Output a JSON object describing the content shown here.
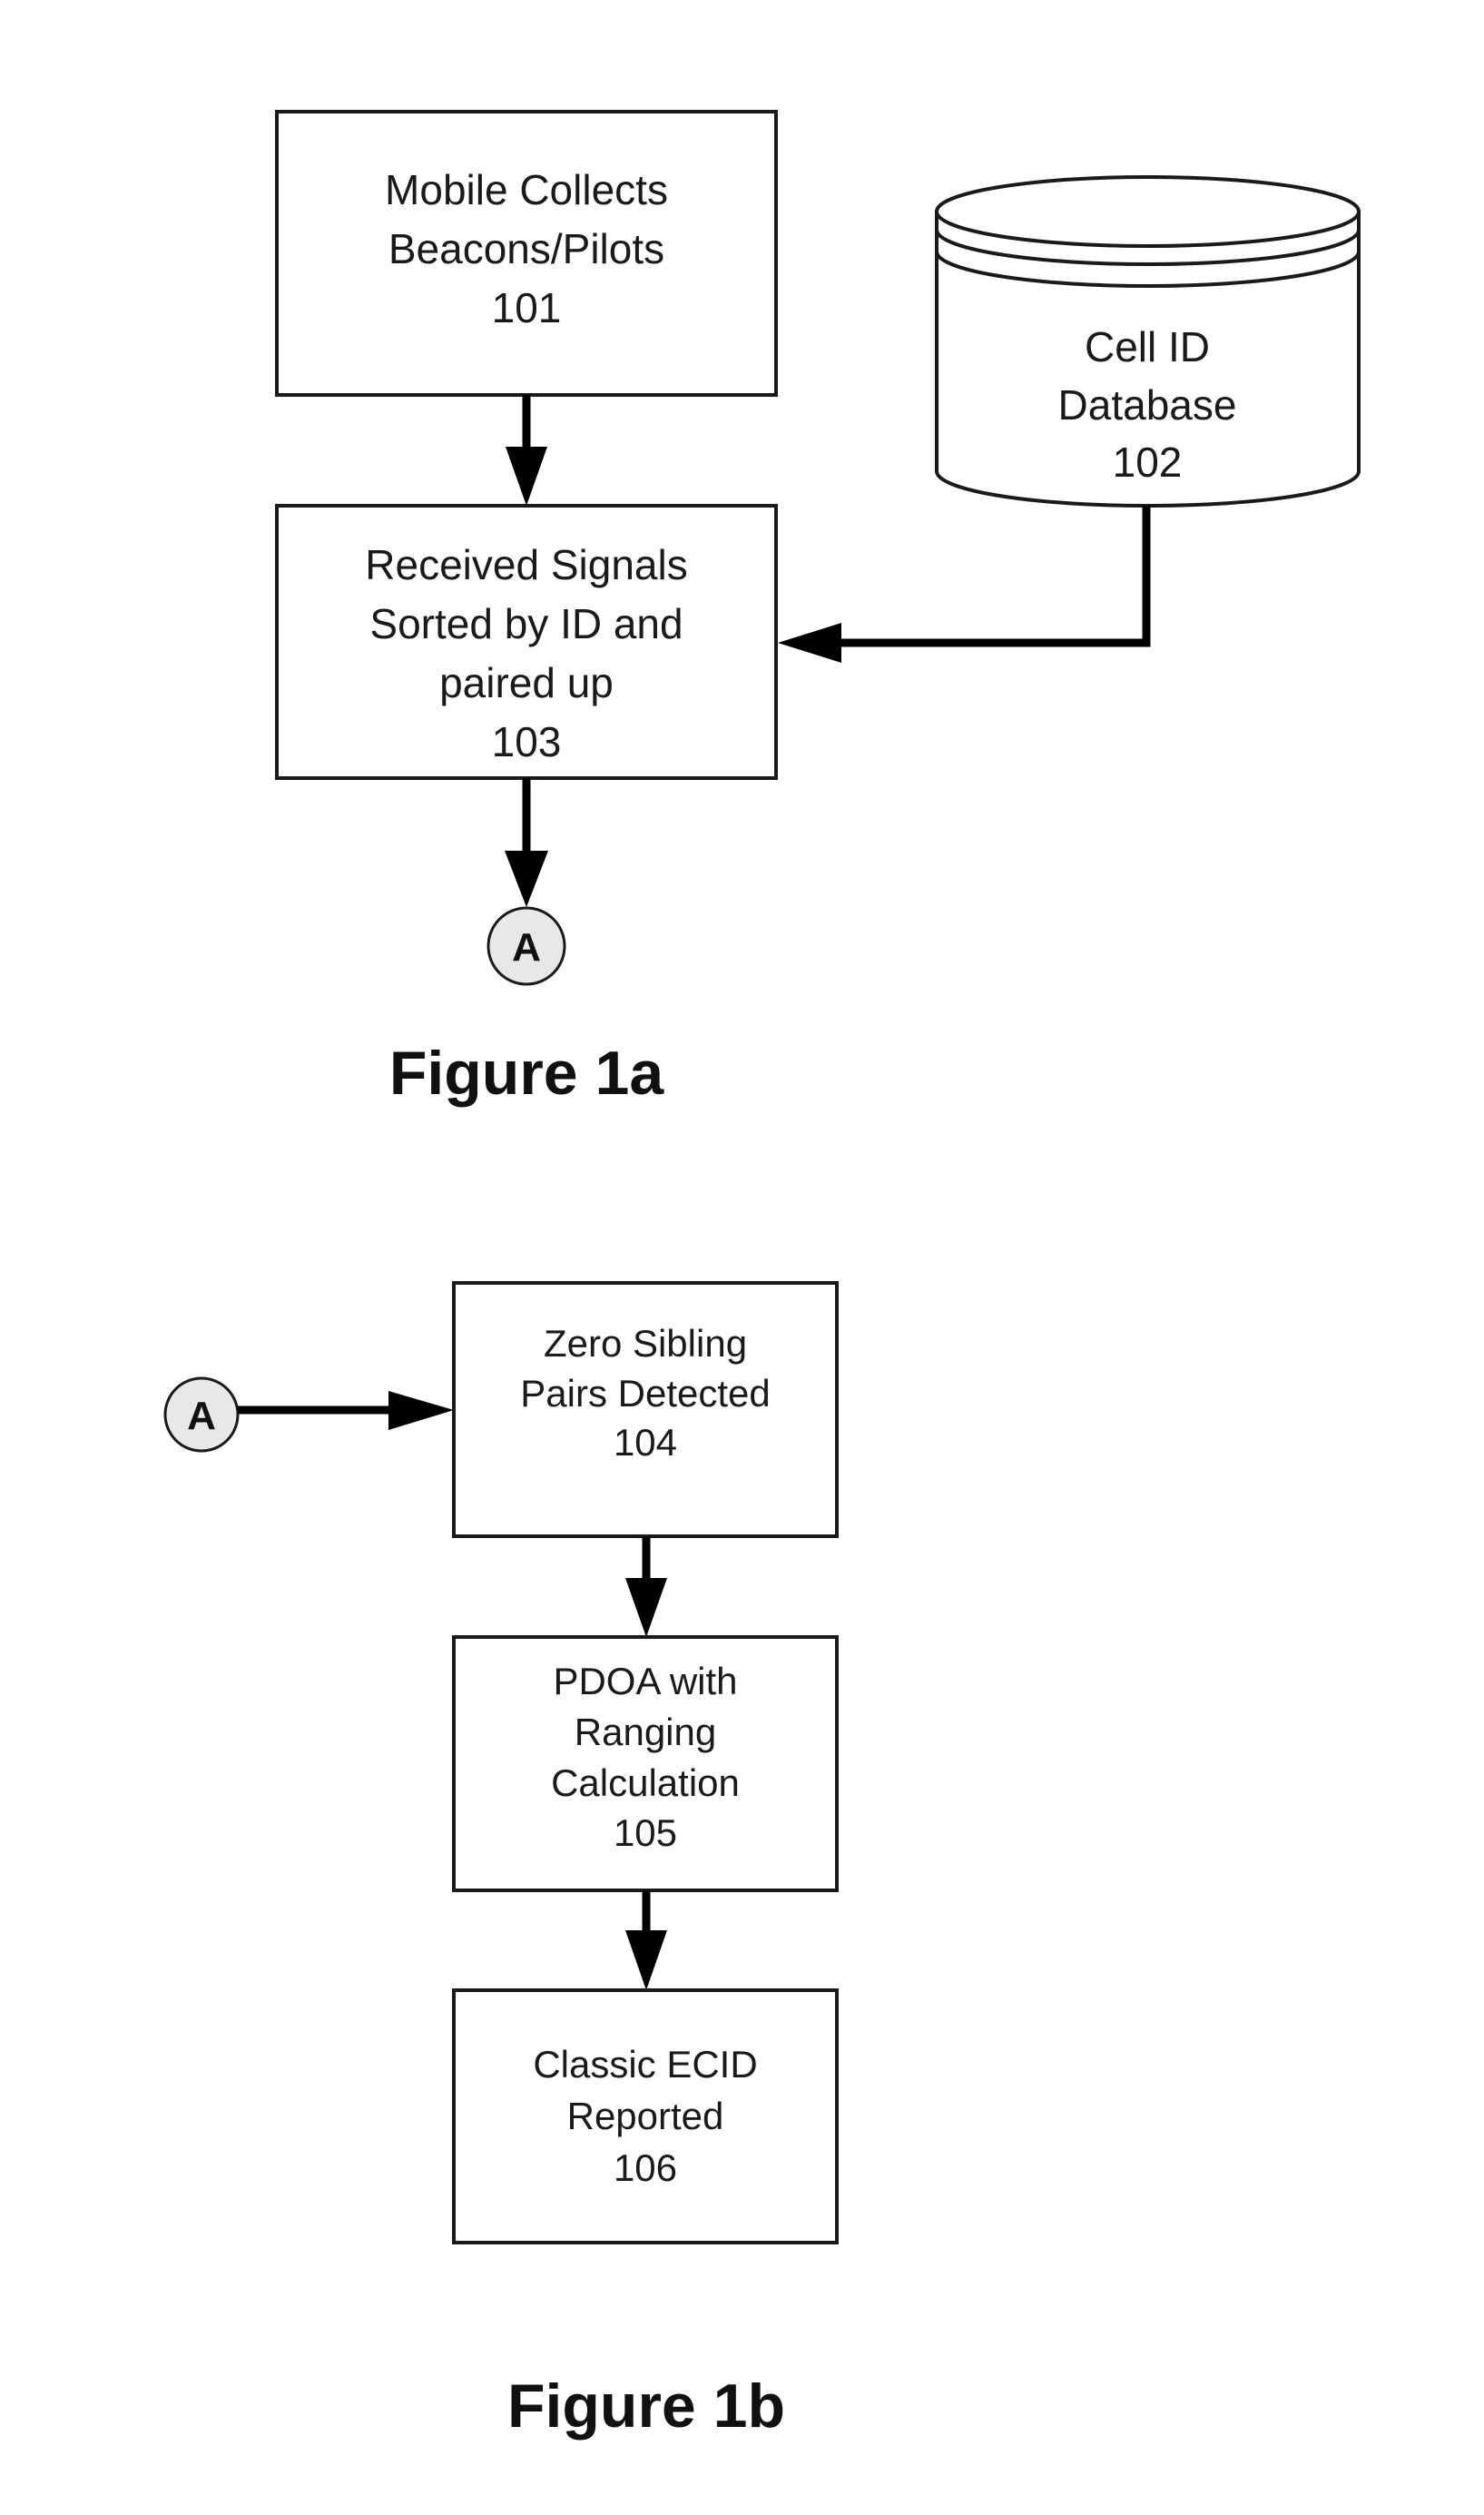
{
  "figure_1a": {
    "caption": "Figure 1a",
    "nodes": {
      "n101": {
        "lines": [
          "Mobile Collects",
          "Beacons/Pilots",
          "101"
        ]
      },
      "n102": {
        "shape": "database-cylinder",
        "lines": [
          "Cell ID",
          "Database",
          "102"
        ]
      },
      "n103": {
        "lines": [
          "Received Signals",
          "Sorted by ID and",
          "paired up",
          "103"
        ]
      }
    },
    "connector": {
      "label": "A"
    },
    "edges": [
      {
        "from": "101",
        "to": "103"
      },
      {
        "from": "102",
        "to": "103"
      },
      {
        "from": "103",
        "to": "A"
      }
    ]
  },
  "figure_1b": {
    "caption": "Figure 1b",
    "connector": {
      "label": "A"
    },
    "nodes": {
      "n104": {
        "lines": [
          "Zero Sibling",
          "Pairs Detected",
          "104"
        ]
      },
      "n105": {
        "lines": [
          "PDOA with",
          "Ranging",
          "Calculation",
          "105"
        ]
      },
      "n106": {
        "lines": [
          "Classic ECID",
          "Reported",
          "106"
        ]
      }
    },
    "edges": [
      {
        "from": "A",
        "to": "104"
      },
      {
        "from": "104",
        "to": "105"
      },
      {
        "from": "105",
        "to": "106"
      }
    ]
  }
}
